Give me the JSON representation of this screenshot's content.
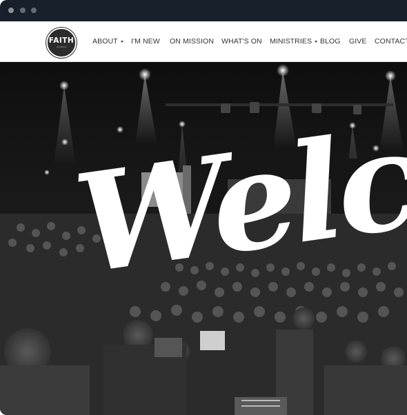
{
  "site": {
    "logo_text": "FAITH",
    "logo_subtext": "CHURCH"
  },
  "nav": {
    "about": "ABOUT",
    "im_new": "I'M NEW",
    "on_mission": "ON MISSION",
    "whats_on": "WHAT'S ON",
    "ministries": "MINISTRIES",
    "blog": "BLOG",
    "give": "GIVE",
    "contact": "CONTACT"
  },
  "hero": {
    "headline": "Welcome"
  },
  "colors": {
    "chrome": "#18202b",
    "nav_text": "#333333",
    "hero_bg": "#1a1a1a",
    "script_text": "#ffffff"
  }
}
